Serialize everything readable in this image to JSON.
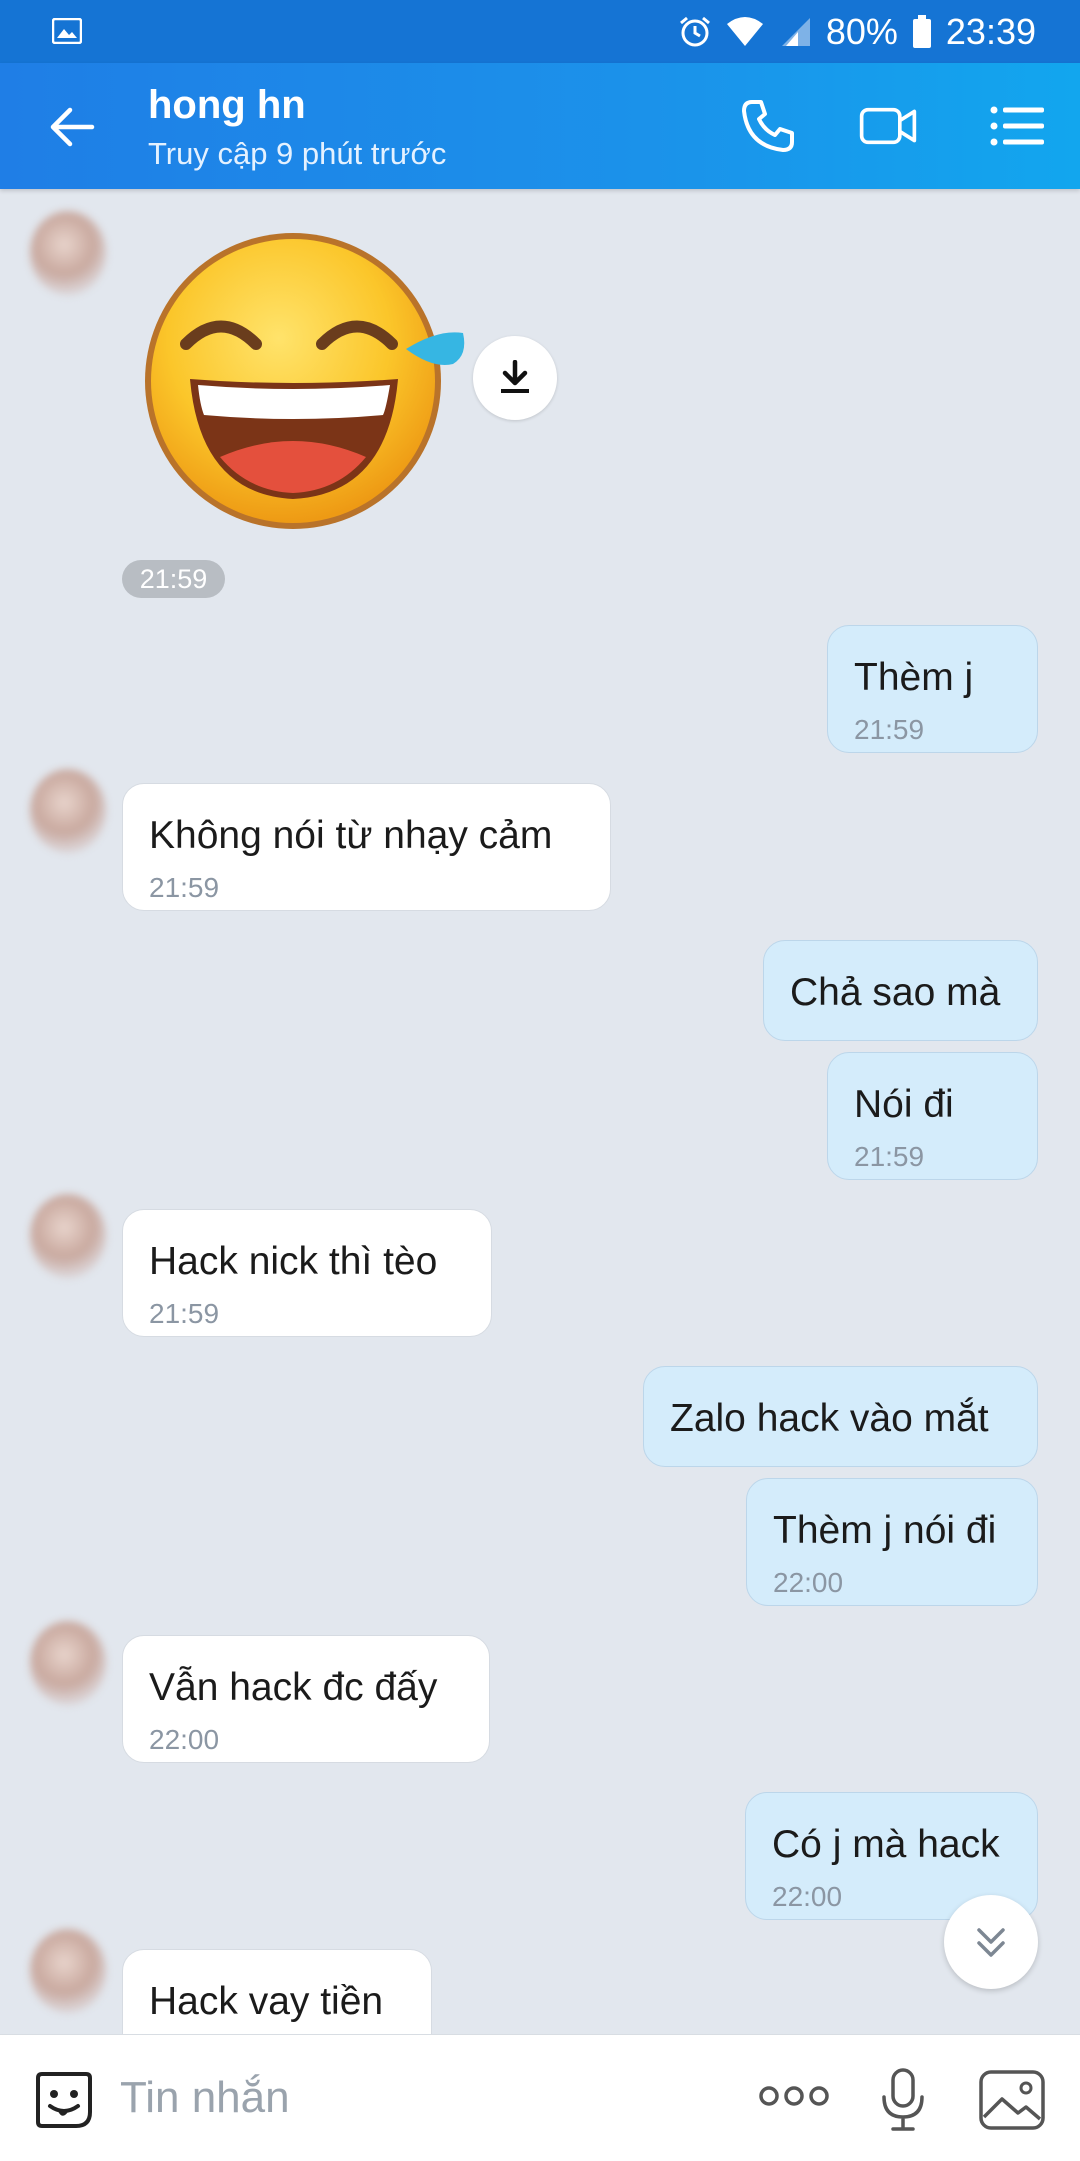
{
  "status_bar": {
    "battery": "80%",
    "time": "23:39"
  },
  "header": {
    "title": "hong hn",
    "subtitle": "Truy cập 9 phút trước"
  },
  "sticker": {
    "time": "21:59"
  },
  "messages": [
    {
      "side": "out",
      "text": "Thèm j",
      "time": "21:59"
    },
    {
      "side": "in",
      "text": "Không nói từ nhạy cảm",
      "time": "21:59"
    },
    {
      "side": "out",
      "text": "Chả sao mà",
      "time": ""
    },
    {
      "side": "out",
      "text": "Nói đi",
      "time": "21:59"
    },
    {
      "side": "in",
      "text": "Hack nick thì tèo",
      "time": "21:59"
    },
    {
      "side": "out",
      "text": "Zalo hack vào mắt",
      "time": ""
    },
    {
      "side": "out",
      "text": "Thèm j nói đi",
      "time": "22:00"
    },
    {
      "side": "in",
      "text": "Vẫn hack đc đấy",
      "time": "22:00"
    },
    {
      "side": "out",
      "text": "Có j mà hack",
      "time": "22:00"
    },
    {
      "side": "in",
      "text": "Hack vay tiền",
      "time": ""
    }
  ],
  "composer": {
    "placeholder": "Tin nhắn"
  },
  "icons": [
    "image-icon",
    "alarm-icon",
    "wifi-icon",
    "signal-icon",
    "battery-icon",
    "back-arrow-icon",
    "phone-icon",
    "video-call-icon",
    "menu-list-icon",
    "download-icon",
    "scroll-down-icon",
    "sticker-icon",
    "more-icon",
    "mic-icon",
    "gallery-icon"
  ]
}
